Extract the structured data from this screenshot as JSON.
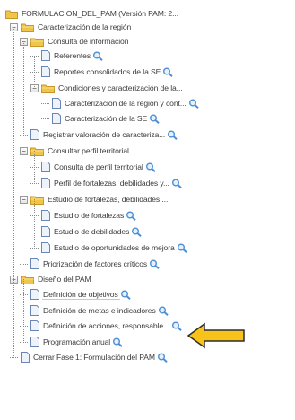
{
  "tree": {
    "root": "FORMULACION_DEL_PAM (Versión PAM: 2...",
    "nodes": [
      {
        "label": "Caracterización de la región",
        "type": "folder",
        "expanded": true,
        "level": 1,
        "has_search": false
      },
      {
        "label": "Consulta de información",
        "type": "folder",
        "expanded": true,
        "level": 2,
        "has_search": false
      },
      {
        "label": "Referentes",
        "type": "doc",
        "level": 3,
        "has_search": true
      },
      {
        "label": "Reportes consolidados de la SE",
        "type": "doc",
        "level": 3,
        "has_search": true
      },
      {
        "label": "Condiciones y caracterización de la...",
        "type": "folder",
        "expanded": true,
        "level": 3,
        "has_search": false
      },
      {
        "label": "Caracterización de la región y cont...",
        "type": "doc",
        "level": 4,
        "has_search": true
      },
      {
        "label": "Caracterización de la SE",
        "type": "doc",
        "level": 4,
        "has_search": true
      },
      {
        "label": "Registrar valoración de caracteriza...",
        "type": "doc",
        "level": 2,
        "has_search": true
      },
      {
        "label": "Consultar perfil territorial",
        "type": "folder",
        "expanded": true,
        "level": 2,
        "has_search": false
      },
      {
        "label": "Consulta de perfil territorial",
        "type": "doc",
        "level": 3,
        "has_search": true
      },
      {
        "label": "Perfil de fortalezas, debilidades y...",
        "type": "doc",
        "level": 3,
        "has_search": true
      },
      {
        "label": "Estudio de fortalezas, debilidades ...",
        "type": "folder",
        "expanded": true,
        "level": 2,
        "has_search": false
      },
      {
        "label": "Estudio de fortalezas",
        "type": "doc",
        "level": 3,
        "has_search": true
      },
      {
        "label": "Estudio de debilidades",
        "type": "doc",
        "level": 3,
        "has_search": true
      },
      {
        "label": "Estudio de oportunidades de mejora",
        "type": "doc",
        "level": 3,
        "has_search": true
      },
      {
        "label": "Priorización de factores críticos",
        "type": "doc",
        "level": 2,
        "has_search": true
      },
      {
        "label": "Diseño del PAM",
        "type": "folder",
        "expanded": true,
        "level": 1,
        "has_search": false
      },
      {
        "label": "Definición de objetivos",
        "type": "doc",
        "level": 2,
        "has_search": true,
        "pointed": true
      },
      {
        "label": "Definición de metas e indicadores",
        "type": "doc",
        "level": 2,
        "has_search": true
      },
      {
        "label": "Definición de acciones, responsable...",
        "type": "doc",
        "level": 2,
        "has_search": true
      },
      {
        "label": "Programación anual",
        "type": "doc",
        "level": 2,
        "has_search": true
      },
      {
        "label": "Cerrar Fase 1: Formulación del PAM",
        "type": "doc",
        "level": 1,
        "has_search": true
      }
    ]
  },
  "colors": {
    "folder": "#f0c64a",
    "folder_dark": "#c9962a",
    "doc_border": "#6a87b4",
    "doc_fill": "#eef3fb",
    "search_icon": "#4d8fd6",
    "arrow_fill": "#f7c21a",
    "arrow_stroke": "#2d2d2d",
    "text": "#3c3c3c"
  },
  "icons": {
    "expand": "minus-box-icon",
    "folder": "folder-icon",
    "doc": "document-icon",
    "search": "magnifier-icon",
    "pointer": "arrow-pointer-icon"
  }
}
